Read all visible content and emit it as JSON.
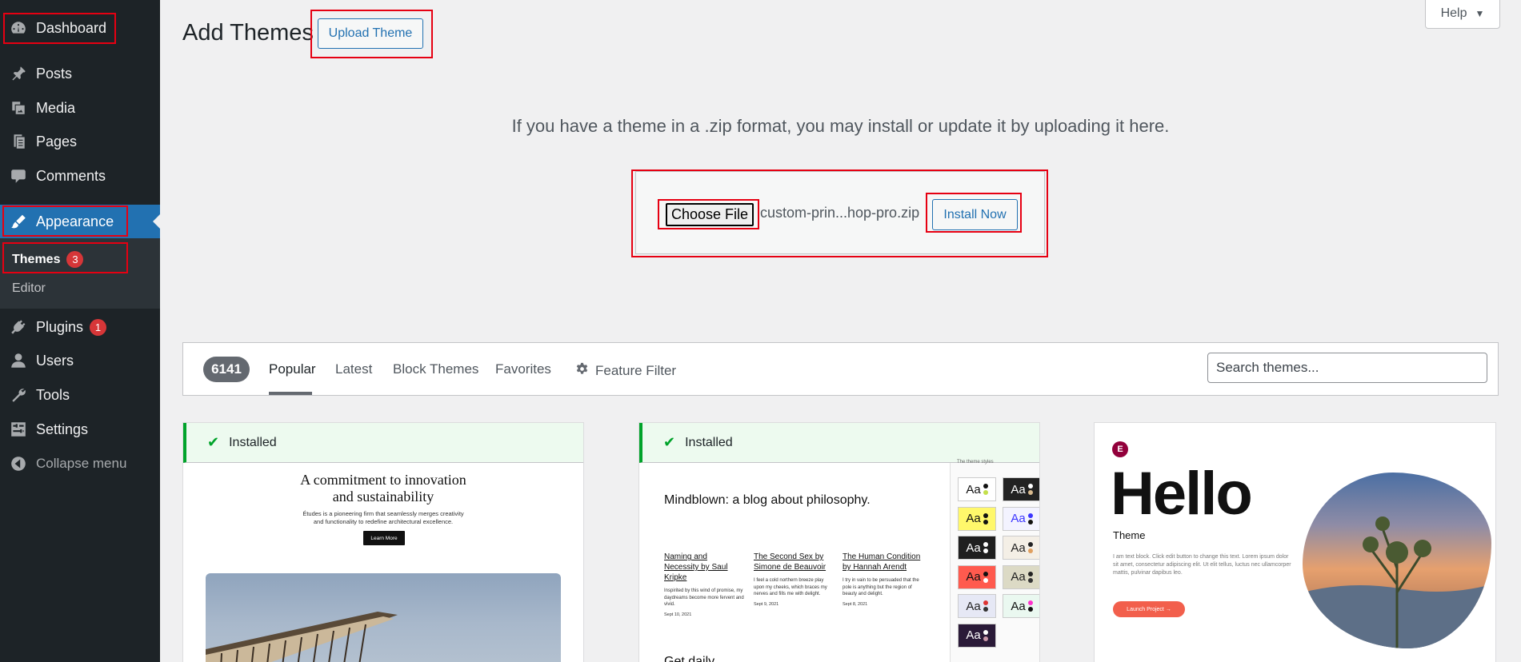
{
  "sidebar": {
    "dashboard": "Dashboard",
    "posts": "Posts",
    "media": "Media",
    "pages": "Pages",
    "comments": "Comments",
    "appearance": "Appearance",
    "themes": "Themes",
    "themes_badge": "3",
    "editor": "Editor",
    "plugins": "Plugins",
    "plugins_badge": "1",
    "users": "Users",
    "tools": "Tools",
    "settings": "Settings",
    "collapse": "Collapse menu"
  },
  "header": {
    "title": "Add Themes",
    "upload_button": "Upload Theme",
    "help": "Help"
  },
  "upload": {
    "description": "If you have a theme in a .zip format, you may install or update it by uploading it here.",
    "choose_file": "Choose File",
    "file_name": "custom-prin...hop-pro.zip",
    "install_button": "Install Now"
  },
  "filter": {
    "count": "6141",
    "tabs": [
      "Popular",
      "Latest",
      "Block Themes",
      "Favorites"
    ],
    "feature_filter": "Feature Filter",
    "search_placeholder": "Search themes..."
  },
  "themes": [
    {
      "status": "Installed",
      "preview": {
        "heading_line1": "A commitment to innovation",
        "heading_line2": "and sustainability",
        "body_line1": "Études is a pioneering firm that seamlessly merges creativity",
        "body_line2": "and functionality to redefine architectural excellence.",
        "button": "Learn More"
      }
    },
    {
      "status": "Installed",
      "preview": {
        "title": "Mindblown: a blog about philosophy.",
        "posts": [
          {
            "title": "Naming and Necessity by Saul Kripke",
            "excerpt": "Inspirited by this wind of promise, my daydreams become more fervent and vivid.",
            "date": "Sept 10, 2021"
          },
          {
            "title": "The Second Sex by Simone de Beauvoir",
            "excerpt": "I feel a cold northern breeze play upon my cheeks, which braces my nerves and fills me with delight.",
            "date": "Sept 9, 2021"
          },
          {
            "title": "The Human Condition by Hannah Arendt",
            "excerpt": "I try in vain to be persuaded that the pole is anything but the region of beauty and delight.",
            "date": "Sept 8, 2021"
          }
        ],
        "get_daily": "Get daily",
        "styles_label": "The theme styles",
        "swatch_text": "Aa"
      }
    },
    {
      "preview": {
        "logo": "E",
        "heading": "Hello",
        "subheading": "Theme",
        "body": "I am text block. Click edit button to change this text. Lorem ipsum dolor sit amet, consectetur adipiscing elit. Ut elit tellus, luctus nec ullamcorper mattis, pulvinar dapibus leo.",
        "button": "Launch Project →"
      }
    }
  ],
  "colors": {
    "sidebar_bg": "#1d2327",
    "accent": "#2271b1",
    "badge": "#d63638",
    "installed_green": "#00a32a",
    "highlight_box": "#e60012"
  }
}
